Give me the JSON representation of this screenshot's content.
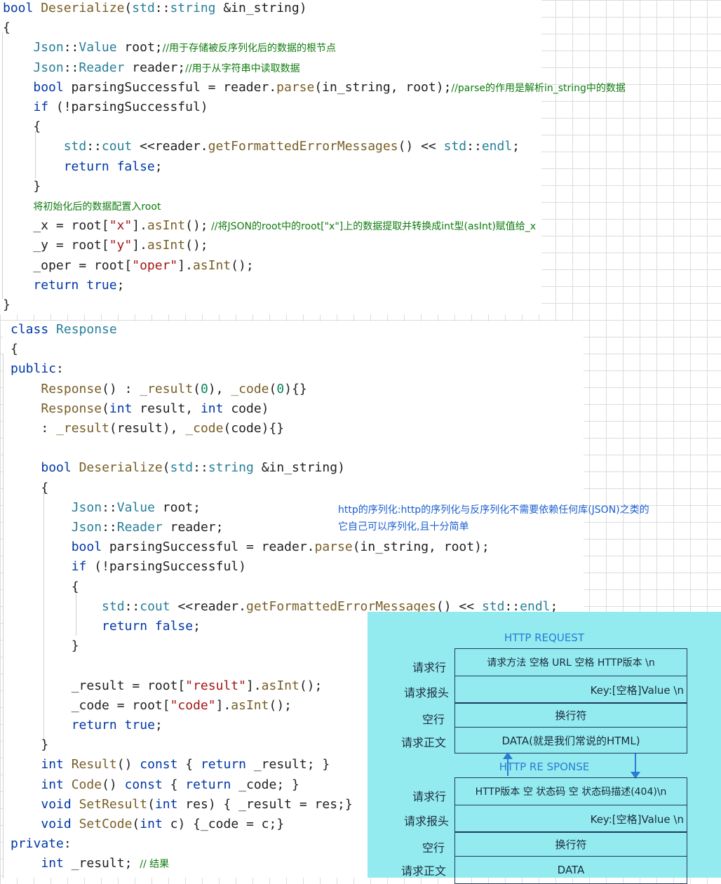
{
  "code_top": {
    "lines": [
      [
        [
          "kw",
          "bool"
        ],
        [
          "",
          " "
        ],
        [
          "fn",
          "Deserialize"
        ],
        [
          "",
          "("
        ],
        [
          "ty",
          "std"
        ],
        [
          "",
          "::"
        ],
        [
          "ty",
          "string"
        ],
        [
          "",
          " &in_string)"
        ]
      ],
      [
        [
          "",
          "{"
        ]
      ],
      [
        [
          "",
          "    "
        ],
        [
          "ty",
          "Json"
        ],
        [
          "",
          "::"
        ],
        [
          "ty",
          "Value"
        ],
        [
          "",
          " root;"
        ],
        [
          "cm",
          "//用于存储被反序列化后的数据的根节点"
        ]
      ],
      [
        [
          "",
          "    "
        ],
        [
          "ty",
          "Json"
        ],
        [
          "",
          "::"
        ],
        [
          "ty",
          "Reader"
        ],
        [
          "",
          " reader;"
        ],
        [
          "cm",
          "//用于从字符串中读取数据"
        ]
      ],
      [
        [
          "",
          "    "
        ],
        [
          "kw",
          "bool"
        ],
        [
          "",
          " parsingSuccessful = reader."
        ],
        [
          "fn",
          "parse"
        ],
        [
          "",
          "(in_string, root);"
        ],
        [
          "cm",
          "//parse的作用是解析in_string中的数据"
        ]
      ],
      [
        [
          "",
          "    "
        ],
        [
          "kw",
          "if"
        ],
        [
          "",
          " (!parsingSuccessful)"
        ]
      ],
      [
        [
          "",
          "    {"
        ]
      ],
      [
        [
          "",
          "        "
        ],
        [
          "ty",
          "std"
        ],
        [
          "",
          "::"
        ],
        [
          "ty",
          "cout"
        ],
        [
          "",
          " <<reader."
        ],
        [
          "fn",
          "getFormattedErrorMessages"
        ],
        [
          "",
          "() << "
        ],
        [
          "ty",
          "std"
        ],
        [
          "",
          "::"
        ],
        [
          "ty",
          "endl"
        ],
        [
          "",
          ";"
        ]
      ],
      [
        [
          "",
          "        "
        ],
        [
          "kw",
          "return"
        ],
        [
          "",
          " "
        ],
        [
          "kw",
          "false"
        ],
        [
          "",
          ";"
        ]
      ],
      [
        [
          "",
          "    }"
        ]
      ],
      [
        [
          "",
          "    "
        ],
        [
          "cm",
          "将初始化后的数据配置入root"
        ]
      ],
      [
        [
          "",
          "    _x = root["
        ],
        [
          "st",
          "\"x\""
        ],
        [
          "",
          "]."
        ],
        [
          "fn",
          "asInt"
        ],
        [
          "",
          "();"
        ],
        [
          "cm",
          " //将JSON的root中的root[\"x\"]上的数据提取并转换成int型(asInt)赋值给_x"
        ]
      ],
      [
        [
          "",
          "    _y = root["
        ],
        [
          "st",
          "\"y\""
        ],
        [
          "",
          "]."
        ],
        [
          "fn",
          "asInt"
        ],
        [
          "",
          "();"
        ]
      ],
      [
        [
          "",
          "    _oper = root["
        ],
        [
          "st",
          "\"oper\""
        ],
        [
          "",
          "]."
        ],
        [
          "fn",
          "asInt"
        ],
        [
          "",
          "();"
        ]
      ],
      [
        [
          "",
          "    "
        ],
        [
          "kw",
          "return"
        ],
        [
          "",
          " "
        ],
        [
          "kw",
          "true"
        ],
        [
          "",
          ";"
        ]
      ],
      [
        [
          "",
          "}"
        ]
      ]
    ]
  },
  "code_bottom": {
    "lines": [
      [
        [
          "kw",
          "class"
        ],
        [
          "",
          " "
        ],
        [
          "ty",
          "Response"
        ]
      ],
      [
        [
          "",
          "{"
        ]
      ],
      [
        [
          "kw",
          "public"
        ],
        [
          "",
          ":"
        ]
      ],
      [
        [
          "",
          "    "
        ],
        [
          "fn",
          "Response"
        ],
        [
          "",
          "() : "
        ],
        [
          "fn",
          "_result"
        ],
        [
          "",
          "("
        ],
        [
          "nm",
          "0"
        ],
        [
          "",
          "), "
        ],
        [
          "fn",
          "_code"
        ],
        [
          "",
          "("
        ],
        [
          "nm",
          "0"
        ],
        [
          "",
          "){}"
        ]
      ],
      [
        [
          "",
          "    "
        ],
        [
          "fn",
          "Response"
        ],
        [
          "",
          "("
        ],
        [
          "kw",
          "int"
        ],
        [
          "",
          " result, "
        ],
        [
          "kw",
          "int"
        ],
        [
          "",
          " code)"
        ]
      ],
      [
        [
          "",
          "    : "
        ],
        [
          "fn",
          "_result"
        ],
        [
          "",
          "(result), "
        ],
        [
          "fn",
          "_code"
        ],
        [
          "",
          "(code){}"
        ]
      ],
      [
        [
          "",
          ""
        ]
      ],
      [
        [
          "",
          "    "
        ],
        [
          "kw",
          "bool"
        ],
        [
          "",
          " "
        ],
        [
          "fn",
          "Deserialize"
        ],
        [
          "",
          "("
        ],
        [
          "ty",
          "std"
        ],
        [
          "",
          "::"
        ],
        [
          "ty",
          "string"
        ],
        [
          "",
          " &in_string)"
        ]
      ],
      [
        [
          "",
          "    {"
        ]
      ],
      [
        [
          "",
          "        "
        ],
        [
          "ty",
          "Json"
        ],
        [
          "",
          "::"
        ],
        [
          "ty",
          "Value"
        ],
        [
          "",
          " root;"
        ]
      ],
      [
        [
          "",
          "        "
        ],
        [
          "ty",
          "Json"
        ],
        [
          "",
          "::"
        ],
        [
          "ty",
          "Reader"
        ],
        [
          "",
          " reader;"
        ]
      ],
      [
        [
          "",
          "        "
        ],
        [
          "kw",
          "bool"
        ],
        [
          "",
          " parsingSuccessful = reader."
        ],
        [
          "fn",
          "parse"
        ],
        [
          "",
          "(in_string, root);"
        ]
      ],
      [
        [
          "",
          "        "
        ],
        [
          "kw",
          "if"
        ],
        [
          "",
          " (!parsingSuccessful)"
        ]
      ],
      [
        [
          "",
          "        {"
        ]
      ],
      [
        [
          "",
          "            "
        ],
        [
          "ty",
          "std"
        ],
        [
          "",
          "::"
        ],
        [
          "ty",
          "cout"
        ],
        [
          "",
          " <<reader."
        ],
        [
          "fn",
          "getFormattedErrorMessages"
        ],
        [
          "",
          "() << "
        ],
        [
          "ty",
          "std"
        ],
        [
          "",
          "::"
        ],
        [
          "ty",
          "endl"
        ],
        [
          "",
          ";"
        ]
      ],
      [
        [
          "",
          "            "
        ],
        [
          "kw",
          "return"
        ],
        [
          "",
          " "
        ],
        [
          "kw",
          "false"
        ],
        [
          "",
          ";"
        ]
      ],
      [
        [
          "",
          "        }"
        ]
      ],
      [
        [
          "",
          ""
        ]
      ],
      [
        [
          "",
          "        _result = root["
        ],
        [
          "st",
          "\"result\""
        ],
        [
          "",
          "]."
        ],
        [
          "fn",
          "asInt"
        ],
        [
          "",
          "();"
        ]
      ],
      [
        [
          "",
          "        _code = root["
        ],
        [
          "st",
          "\"code\""
        ],
        [
          "",
          "]."
        ],
        [
          "fn",
          "asInt"
        ],
        [
          "",
          "();"
        ]
      ],
      [
        [
          "",
          "        "
        ],
        [
          "kw",
          "return"
        ],
        [
          "",
          " "
        ],
        [
          "kw",
          "true"
        ],
        [
          "",
          ";"
        ]
      ],
      [
        [
          "",
          "    }"
        ]
      ],
      [
        [
          "",
          "    "
        ],
        [
          "kw",
          "int"
        ],
        [
          "",
          " "
        ],
        [
          "fn",
          "Result"
        ],
        [
          "",
          "() "
        ],
        [
          "kw",
          "const"
        ],
        [
          "",
          " { "
        ],
        [
          "kw",
          "return"
        ],
        [
          "",
          " _result; }"
        ]
      ],
      [
        [
          "",
          "    "
        ],
        [
          "kw",
          "int"
        ],
        [
          "",
          " "
        ],
        [
          "fn",
          "Code"
        ],
        [
          "",
          "() "
        ],
        [
          "kw",
          "const"
        ],
        [
          "",
          " { "
        ],
        [
          "kw",
          "return"
        ],
        [
          "",
          " _code; }"
        ]
      ],
      [
        [
          "",
          "    "
        ],
        [
          "kw",
          "void"
        ],
        [
          "",
          " "
        ],
        [
          "fn",
          "SetResult"
        ],
        [
          "",
          "("
        ],
        [
          "kw",
          "int"
        ],
        [
          "",
          " res) { _result = res;}"
        ]
      ],
      [
        [
          "",
          "    "
        ],
        [
          "kw",
          "void"
        ],
        [
          "",
          " "
        ],
        [
          "fn",
          "SetCode"
        ],
        [
          "",
          "("
        ],
        [
          "kw",
          "int"
        ],
        [
          "",
          " c) {_code = c;}"
        ]
      ],
      [
        [
          "kw",
          "private"
        ],
        [
          "",
          ":"
        ]
      ],
      [
        [
          "",
          "    "
        ],
        [
          "kw",
          "int"
        ],
        [
          "",
          " _result; "
        ],
        [
          "cm",
          "// 结果"
        ]
      ]
    ]
  },
  "annotation_http": {
    "line1": "http的序列化:http的序列化与反序列化不需要依赖任何库(JSON)之类的",
    "line2": "它自己可以序列化,且十分简单"
  },
  "http_diagram": {
    "request_title": "HTTP REQUEST",
    "response_title": "HTTP RE SPONSE",
    "request": {
      "labels": [
        "请求行",
        "请求报头",
        "空行",
        "请求正文"
      ],
      "rows": [
        "请求方法 空格 URL 空格 HTTP版本 \\n",
        "Key:[空格]Value \\n",
        "换行符",
        "DATA(就是我们常说的HTML)"
      ]
    },
    "response": {
      "labels": [
        "请求行",
        "请求报头",
        "空行",
        "请求正文"
      ],
      "rows": [
        "HTTP版本 空 状态码 空 状态码描述(404)\\n",
        "Key:[空格]Value \\n",
        "换行符",
        "DATA"
      ]
    }
  }
}
